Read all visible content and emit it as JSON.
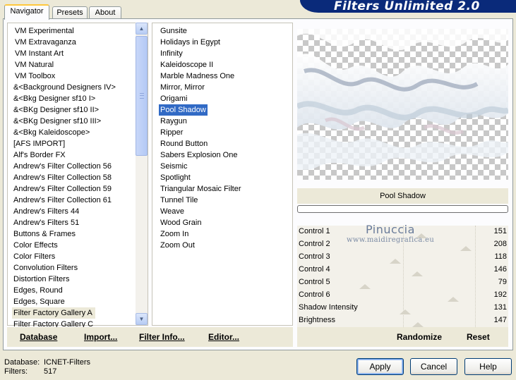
{
  "banner": {
    "title": "Filters Unlimited 2.0"
  },
  "tabs": [
    {
      "label": "Navigator",
      "active": true
    },
    {
      "label": "Presets",
      "active": false
    },
    {
      "label": "About",
      "active": false
    }
  ],
  "categories": {
    "highlighted": "Filter Factory Gallery A",
    "items": [
      "VM Experimental",
      "VM Extravaganza",
      "VM Instant Art",
      "VM Natural",
      "VM Toolbox",
      "&<Background Designers IV>",
      "&<Bkg Designer sf10 I>",
      "&<BKg Designer sf10 II>",
      "&<BKg Designer sf10 III>",
      "&<Bkg Kaleidoscope>",
      "[AFS IMPORT]",
      "Alf's Border FX",
      "Andrew's Filter Collection 56",
      "Andrew's Filter Collection 58",
      "Andrew's Filter Collection 59",
      "Andrew's Filter Collection 61",
      "Andrew's Filters 44",
      "Andrew's Filters 51",
      "Buttons & Frames",
      "Color Effects",
      "Color Filters",
      "Convolution Filters",
      "Distortion Filters",
      "Edges, Round",
      "Edges, Square",
      "Filter Factory Gallery A",
      "Filter Factory Gallery C"
    ]
  },
  "filters": {
    "selected": "Pool Shadow",
    "items": [
      "Gunsite",
      "Holidays in Egypt",
      "Infinity",
      "Kaleidoscope II",
      "Marble Madness One",
      "Mirror, Mirror",
      "Origami",
      "Pool Shadow",
      "Raygun",
      "Ripper",
      "Round Button",
      "Sabers Explosion One",
      "Seismic",
      "Spotlight",
      "Triangular Mosaic Filter",
      "Tunnel Tile",
      "Weave",
      "Wood Grain",
      "Zoom In",
      "Zoom Out"
    ]
  },
  "left_bar": {
    "database": "Database",
    "import": "Import...",
    "filter_info": "Filter Info...",
    "editor": "Editor..."
  },
  "preview": {
    "filter_name": "Pool Shadow"
  },
  "controls": [
    {
      "label": "Control 1",
      "value": 151
    },
    {
      "label": "Control 2",
      "value": 208
    },
    {
      "label": "Control 3",
      "value": 118
    },
    {
      "label": "Control 4",
      "value": 146
    },
    {
      "label": "Control 5",
      "value": 79
    },
    {
      "label": "Control 6",
      "value": 192
    },
    {
      "label": "Shadow Intensity",
      "value": 131
    },
    {
      "label": "Brightness",
      "value": 147
    }
  ],
  "right_bar": {
    "randomize": "Randomize",
    "reset": "Reset"
  },
  "watermark": {
    "name": "Pinuccia",
    "url": "www.maidiregrafica.eu"
  },
  "status": {
    "database_label": "Database:",
    "database_value": "ICNET-Filters",
    "filters_label": "Filters:",
    "filters_value": "517"
  },
  "buttons": {
    "apply": "Apply",
    "cancel": "Cancel",
    "help": "Help"
  }
}
